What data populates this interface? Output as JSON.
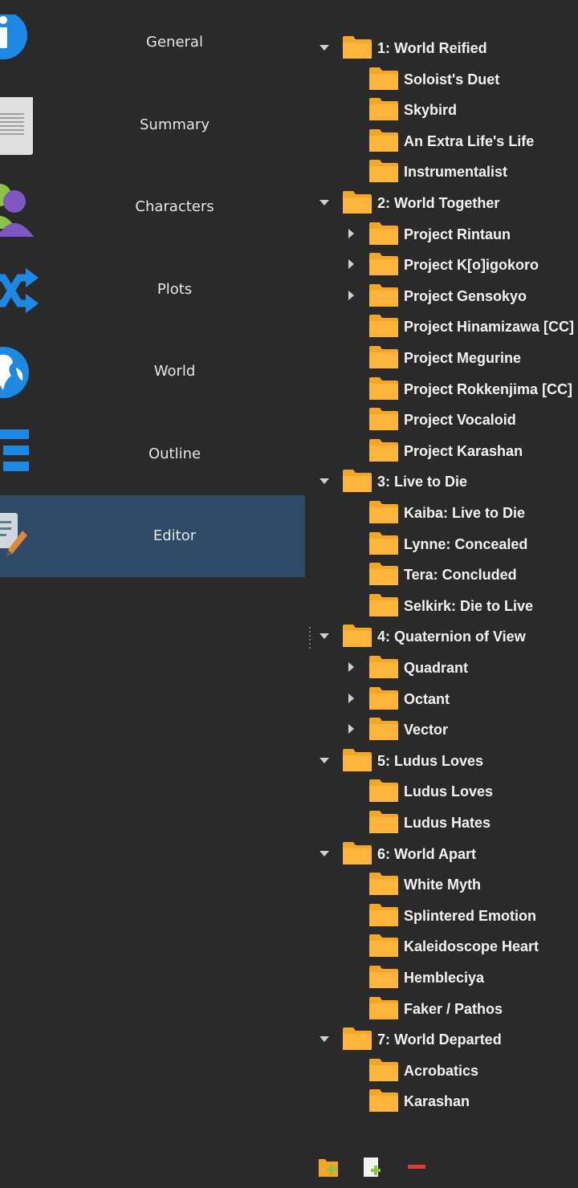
{
  "sidebar": {
    "items": [
      {
        "label": "General",
        "icon": "info-icon"
      },
      {
        "label": "Summary",
        "icon": "document-icon"
      },
      {
        "label": "Characters",
        "icon": "users-icon"
      },
      {
        "label": "Plots",
        "icon": "shuffle-icon"
      },
      {
        "label": "World",
        "icon": "globe-icon"
      },
      {
        "label": "Outline",
        "icon": "outline-list-icon"
      },
      {
        "label": "Editor",
        "icon": "edit-document-icon"
      }
    ],
    "active_label": "Editor",
    "active_color": "#2f4a66"
  },
  "tree": {
    "rows": [
      {
        "label": "1: World Reified",
        "level": 0,
        "arrow": "expanded"
      },
      {
        "label": "Soloist's Duet",
        "level": 1,
        "arrow": "none"
      },
      {
        "label": "Skybird",
        "level": 1,
        "arrow": "none"
      },
      {
        "label": "An Extra Life's Life",
        "level": 1,
        "arrow": "none"
      },
      {
        "label": "Instrumentalist",
        "level": 1,
        "arrow": "none"
      },
      {
        "label": "2: World Together",
        "level": 0,
        "arrow": "expanded"
      },
      {
        "label": "Project Rintaun",
        "level": 1,
        "arrow": "collapsed"
      },
      {
        "label": "Project K[o]igokoro",
        "level": 1,
        "arrow": "collapsed"
      },
      {
        "label": "Project Gensokyo",
        "level": 1,
        "arrow": "collapsed"
      },
      {
        "label": "Project Hinamizawa [CC]",
        "level": 1,
        "arrow": "none"
      },
      {
        "label": "Project Megurine",
        "level": 1,
        "arrow": "none"
      },
      {
        "label": "Project Rokkenjima [CC]",
        "level": 1,
        "arrow": "none"
      },
      {
        "label": "Project Vocaloid",
        "level": 1,
        "arrow": "none"
      },
      {
        "label": "Project Karashan",
        "level": 1,
        "arrow": "none"
      },
      {
        "label": "3: Live to Die",
        "level": 0,
        "arrow": "expanded"
      },
      {
        "label": "Kaiba: Live to Die",
        "level": 1,
        "arrow": "none"
      },
      {
        "label": "Lynne: Concealed",
        "level": 1,
        "arrow": "none"
      },
      {
        "label": "Tera: Concluded",
        "level": 1,
        "arrow": "none"
      },
      {
        "label": "Selkirk: Die to Live",
        "level": 1,
        "arrow": "none"
      },
      {
        "label": "4: Quaternion of View",
        "level": 0,
        "arrow": "expanded"
      },
      {
        "label": "Quadrant",
        "level": 1,
        "arrow": "collapsed"
      },
      {
        "label": "Octant",
        "level": 1,
        "arrow": "collapsed"
      },
      {
        "label": "Vector",
        "level": 1,
        "arrow": "collapsed"
      },
      {
        "label": "5: Ludus Loves",
        "level": 0,
        "arrow": "expanded"
      },
      {
        "label": "Ludus Loves",
        "level": 1,
        "arrow": "none"
      },
      {
        "label": "Ludus Hates",
        "level": 1,
        "arrow": "none"
      },
      {
        "label": "6: World Apart",
        "level": 0,
        "arrow": "expanded"
      },
      {
        "label": "White Myth",
        "level": 1,
        "arrow": "none"
      },
      {
        "label": "Splintered Emotion",
        "level": 1,
        "arrow": "none"
      },
      {
        "label": "Kaleidoscope Heart",
        "level": 1,
        "arrow": "none"
      },
      {
        "label": "Hembleciya",
        "level": 1,
        "arrow": "none"
      },
      {
        "label": "Faker / Pathos",
        "level": 1,
        "arrow": "none"
      },
      {
        "label": "7: World Departed",
        "level": 0,
        "arrow": "expanded"
      },
      {
        "label": "Acrobatics",
        "level": 1,
        "arrow": "none"
      },
      {
        "label": "Karashan",
        "level": 1,
        "arrow": "none"
      }
    ]
  },
  "toolbar": {
    "buttons": [
      {
        "icon": "add-folder-icon"
      },
      {
        "icon": "add-text-icon"
      },
      {
        "icon": "remove-icon"
      }
    ]
  },
  "colors": {
    "background": "#2a2a2a",
    "folder": "#f5a623",
    "accent_blue": "#1e88e5",
    "remove_red": "#e53935",
    "add_green": "#8bc34a"
  }
}
